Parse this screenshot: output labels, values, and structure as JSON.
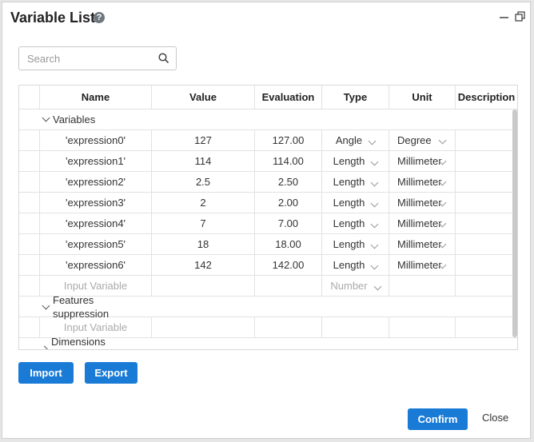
{
  "dialog": {
    "title": "Variable List",
    "help_icon": "?",
    "minimize_icon": "minimize-icon",
    "restore_icon": "restore-icon"
  },
  "search": {
    "placeholder": "Search",
    "icon": "search-icon"
  },
  "table": {
    "columns": [
      "Name",
      "Value",
      "Evaluation",
      "Type",
      "Unit",
      "Description"
    ],
    "groups": {
      "variables": "Variables",
      "features": "Features\nsuppression",
      "dimensions": "Dimensions"
    },
    "rows": [
      {
        "name": "'expression0'",
        "value": "127",
        "evaluation": "127.00",
        "type": "Angle",
        "unit": "Degree"
      },
      {
        "name": "'expression1'",
        "value": "114",
        "evaluation": "114.00",
        "type": "Length",
        "unit": "Millimeter"
      },
      {
        "name": "'expression2'",
        "value": "2.5",
        "evaluation": "2.50",
        "type": "Length",
        "unit": "Millimeter"
      },
      {
        "name": "'expression3'",
        "value": "2",
        "evaluation": "2.00",
        "type": "Length",
        "unit": "Millimeter"
      },
      {
        "name": "'expression4'",
        "value": "7",
        "evaluation": "7.00",
        "type": "Length",
        "unit": "Millimeter"
      },
      {
        "name": "'expression5'",
        "value": "18",
        "evaluation": "18.00",
        "type": "Length",
        "unit": "Millimeter"
      },
      {
        "name": "'expression6'",
        "value": "142",
        "evaluation": "142.00",
        "type": "Length",
        "unit": "Millimeter"
      }
    ],
    "input_variable_placeholder": "Input Variable",
    "input_type_placeholder": "Number"
  },
  "buttons": {
    "import": "Import",
    "export": "Export",
    "confirm": "Confirm",
    "close": "Close"
  },
  "colors": {
    "primary": "#1a7bd6"
  }
}
